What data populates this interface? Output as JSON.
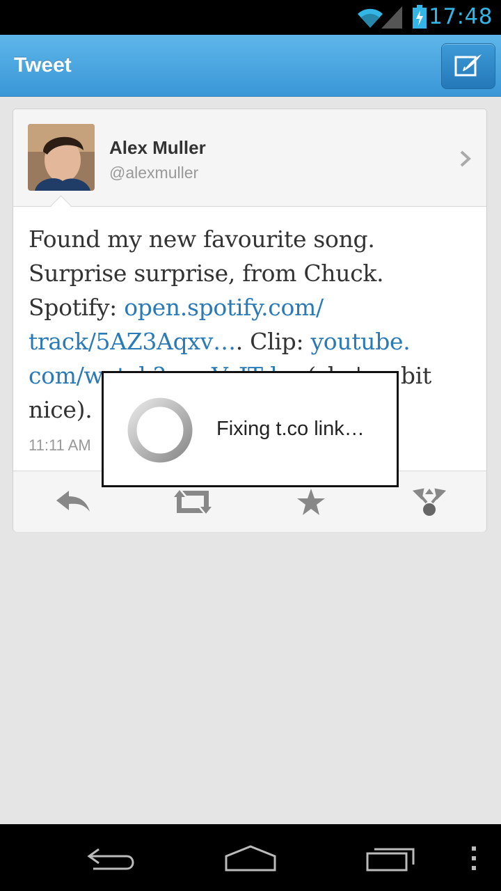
{
  "status_bar": {
    "time": "17:48",
    "icons": [
      "wifi-icon",
      "signal-icon",
      "battery-charging-icon"
    ]
  },
  "action_bar": {
    "title": "Tweet",
    "compose_icon": "compose-icon"
  },
  "tweet": {
    "author_name": "Alex Muller",
    "author_handle": "@alexmuller",
    "text_parts": [
      "Found my new favourite song. Surprise surprise, from Chuck. Spotify: ",
      "open.spotify.com/ track/5AZ3Aqxv…",
      ". Clip: ",
      "youtube. com/watch?v=nVrJTd…",
      " (she's a bit nice)."
    ],
    "timestamp": "11:11 AM",
    "actions": [
      "reply-icon",
      "retweet-icon",
      "favorite-icon",
      "share-icon"
    ]
  },
  "dialog": {
    "message": "Fixing t.co link…"
  },
  "nav_bar": {
    "buttons": [
      "back-icon",
      "home-icon",
      "recent-apps-icon",
      "menu-icon"
    ]
  },
  "colors": {
    "accent": "#33b5e5",
    "action_bar": "#4aa8e2",
    "link": "#2a7ab7"
  }
}
